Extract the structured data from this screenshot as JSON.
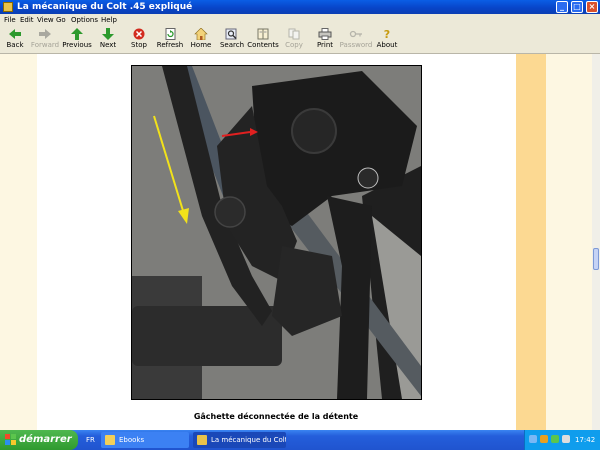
{
  "window": {
    "title": "La mécanique du Colt .45 expliqué"
  },
  "menu": [
    "File",
    "Edit",
    "View",
    "Go",
    "Options",
    "Help"
  ],
  "toolbar": {
    "back": "Back",
    "forward": "Forward",
    "previous": "Previous",
    "next": "Next",
    "stop": "Stop",
    "refresh": "Refresh",
    "home": "Home",
    "search": "Search",
    "contents": "Contents",
    "copy": "Copy",
    "print": "Print",
    "password": "Password",
    "about": "About"
  },
  "content": {
    "caption": "Gâchette déconnectée de la détente"
  },
  "taskbar": {
    "start": "démarrer",
    "lang": "FR",
    "tasks": [
      "Ebooks",
      "La mécanique du Colt..."
    ],
    "clock": "17:42"
  },
  "icons": {
    "back": "arrow-left-icon",
    "forward": "arrow-right-icon",
    "previous": "arrow-up-icon",
    "next": "arrow-down-icon",
    "stop": "stop-icon",
    "refresh": "refresh-icon",
    "home": "home-icon",
    "search": "search-icon",
    "contents": "book-icon",
    "copy": "copy-icon",
    "print": "printer-icon",
    "password": "key-icon",
    "about": "question-icon"
  },
  "colors": {
    "titlebar": "#0845c9",
    "band": "#fcd992",
    "start": "#2f9a2f"
  }
}
